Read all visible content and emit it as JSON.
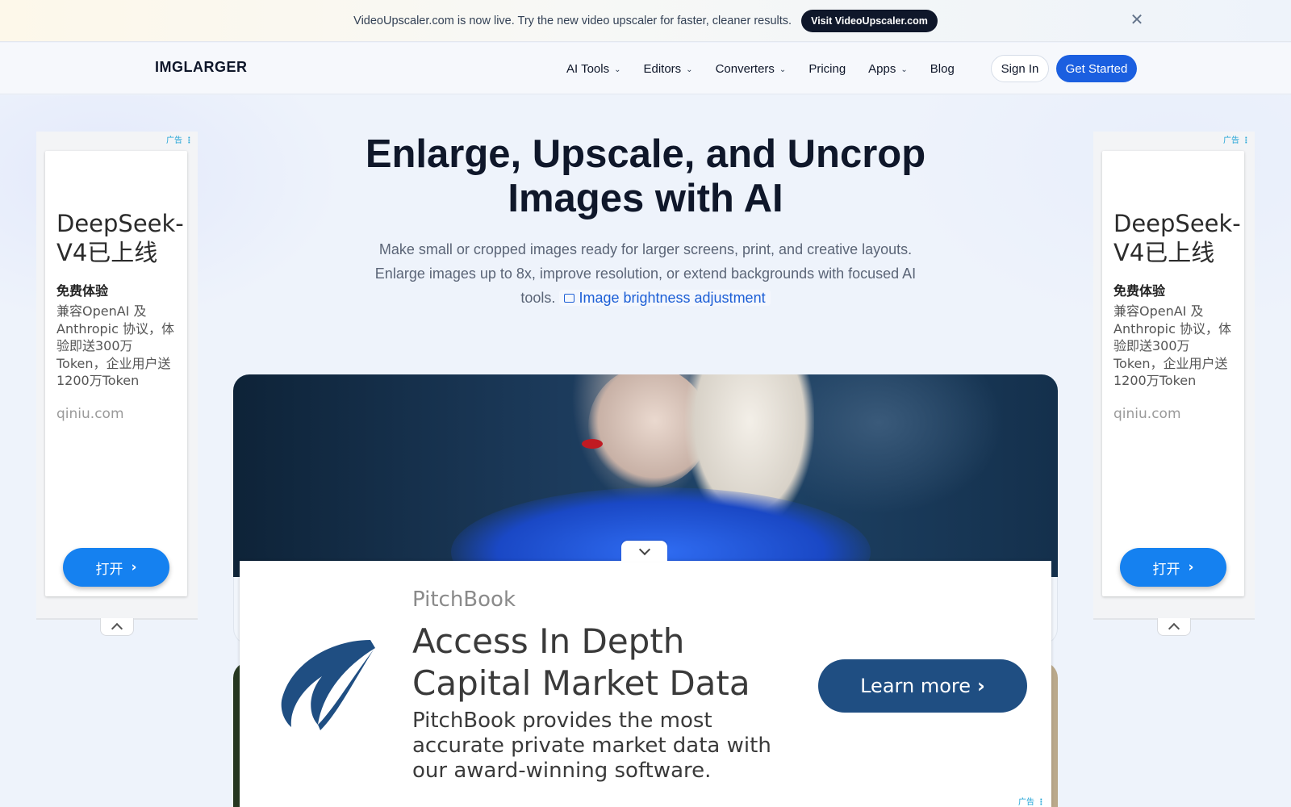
{
  "announcement": {
    "text": "VideoUpscaler.com is now live. Try the new video upscaler for faster, cleaner results.",
    "button_label": "Visit VideoUpscaler.com",
    "close_glyph": "✕"
  },
  "nav": {
    "logo": "IMGLARGER",
    "items": [
      {
        "label": "AI Tools",
        "dropdown": true
      },
      {
        "label": "Editors",
        "dropdown": true
      },
      {
        "label": "Converters",
        "dropdown": true
      },
      {
        "label": "Pricing",
        "dropdown": false
      },
      {
        "label": "Apps",
        "dropdown": true
      },
      {
        "label": "Blog",
        "dropdown": false
      }
    ],
    "sign_in": "Sign In",
    "get_started": "Get Started"
  },
  "hero": {
    "title": "Enlarge, Upscale, and Uncrop Images with AI",
    "subtitle": "Make small or cropped images ready for larger screens, print, and creative layouts. Enlarge images up to 8x, improve resolution, or extend backgrounds with focused AI tools.",
    "link_label": "Image brightness adjustment",
    "link_icon": "article-icon"
  },
  "side_ad": {
    "ad_label": "广告",
    "title": "DeepSeek-V4已上线",
    "subtitle": "免费体验",
    "body": "兼容OpenAI 及 Anthropic 协议，体验即送300万Token，企业用户送1200万Token",
    "domain": "qiniu.com",
    "button": "打开"
  },
  "bottom_ad": {
    "ad_label": "广告",
    "brand": "PitchBook",
    "title": "Access In Depth Capital Market Data",
    "description": "PitchBook provides the most accurate private market data with our award-winning software.",
    "button": "Learn more"
  },
  "colors": {
    "primary": "#1b5fe0",
    "ad_button": "#1581f0",
    "pitchbook": "#1f4e82"
  }
}
